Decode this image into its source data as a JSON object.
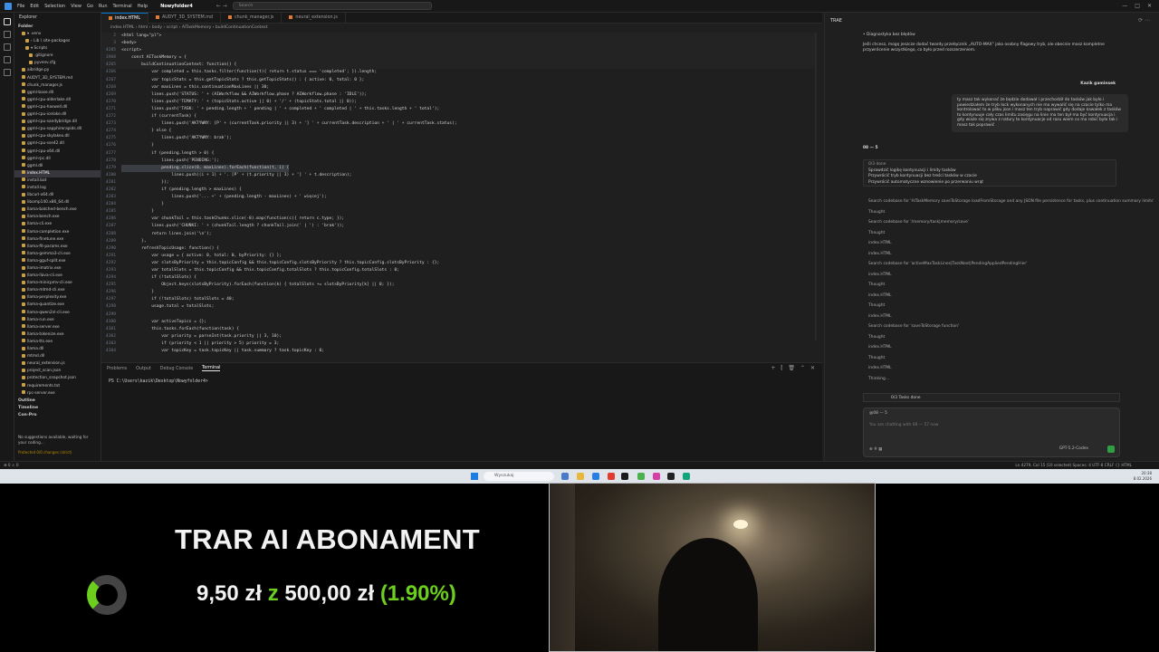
{
  "menu": [
    "File",
    "Edit",
    "Selection",
    "View",
    "Go",
    "Run",
    "Terminal",
    "Help"
  ],
  "project": "Nowyfolder4",
  "search_placeholder": "Search",
  "explorer": {
    "title": "Explorer",
    "root": "Folder",
    "items": [
      {
        "label": "▾ .venv",
        "indent": 8
      },
      {
        "label": "› Lib \\ site-packages",
        "indent": 12
      },
      {
        "label": "▾ Scripts",
        "indent": 12
      },
      {
        "label": ".gitignore",
        "indent": 16
      },
      {
        "label": "pyvenv.cfg",
        "indent": 16
      },
      {
        "label": "aibridge.py",
        "indent": 8
      },
      {
        "label": "AUDYT_3D_SYSTEM.md",
        "indent": 8
      },
      {
        "label": "chunk_manager.js",
        "indent": 8
      },
      {
        "label": "ggml-base.dll",
        "indent": 8
      },
      {
        "label": "ggml-cpu-alderlake.dll",
        "indent": 8
      },
      {
        "label": "ggml-cpu-haswell.dll",
        "indent": 8
      },
      {
        "label": "ggml-cpu-icelake.dll",
        "indent": 8
      },
      {
        "label": "ggml-cpu-sandybridge.dll",
        "indent": 8
      },
      {
        "label": "ggml-cpu-sapphirerapids.dll",
        "indent": 8
      },
      {
        "label": "ggml-cpu-skylakex.dll",
        "indent": 8
      },
      {
        "label": "ggml-cpu-sse42.dll",
        "indent": 8
      },
      {
        "label": "ggml-cpu-x64.dll",
        "indent": 8
      },
      {
        "label": "ggml-rpc.dll",
        "indent": 8
      },
      {
        "label": "ggml.dll",
        "indent": 8
      },
      {
        "label": "index.HTML",
        "indent": 8,
        "selected": true
      },
      {
        "label": "install.bat",
        "indent": 8
      },
      {
        "label": "install.log",
        "indent": 8
      },
      {
        "label": "libcurl-x64.dll",
        "indent": 8
      },
      {
        "label": "libomp140.x86_64.dll",
        "indent": 8
      },
      {
        "label": "llama-batched-bench.exe",
        "indent": 8
      },
      {
        "label": "llama-bench.exe",
        "indent": 8
      },
      {
        "label": "llama-cli.exe",
        "indent": 8
      },
      {
        "label": "llama-completion.exe",
        "indent": 8
      },
      {
        "label": "llama-finetune.exe",
        "indent": 8
      },
      {
        "label": "llama-fit-params.exe",
        "indent": 8
      },
      {
        "label": "llama-gemma3-cli.exe",
        "indent": 8
      },
      {
        "label": "llama-gguf-split.exe",
        "indent": 8
      },
      {
        "label": "llama-imatrix.exe",
        "indent": 8
      },
      {
        "label": "llama-llava-cli.exe",
        "indent": 8
      },
      {
        "label": "llama-minicpmv-cli.exe",
        "indent": 8
      },
      {
        "label": "llama-mtmd-cli.exe",
        "indent": 8
      },
      {
        "label": "llama-perplexity.exe",
        "indent": 8
      },
      {
        "label": "llama-quantize.exe",
        "indent": 8
      },
      {
        "label": "llama-qwen2vl-cli.exe",
        "indent": 8
      },
      {
        "label": "llama-run.exe",
        "indent": 8
      },
      {
        "label": "llama-server.exe",
        "indent": 8
      },
      {
        "label": "llama-tokenize.exe",
        "indent": 8
      },
      {
        "label": "llama-tts.exe",
        "indent": 8
      },
      {
        "label": "llama.dll",
        "indent": 8
      },
      {
        "label": "mtmd.dll",
        "indent": 8
      },
      {
        "label": "neural_extension.js",
        "indent": 8
      },
      {
        "label": "project_scan.json",
        "indent": 8
      },
      {
        "label": "protection_snapshot.json",
        "indent": 8
      },
      {
        "label": "requirements.txt",
        "indent": 8
      },
      {
        "label": "rpc-server.exe",
        "indent": 8
      }
    ],
    "outline": "Outline",
    "timeline": "Timeline",
    "section3": "Con-Pro",
    "note": "No suggestions available, waiting for your coding...",
    "note2": "Protected 0/0 changes (strict)"
  },
  "tabs": [
    {
      "label": "index.HTML",
      "active": true
    },
    {
      "label": "AUDYT_3D_SYSTEM.md",
      "active": false
    },
    {
      "label": "chunk_manager.js",
      "active": false
    },
    {
      "label": "neural_extension.js",
      "active": false
    }
  ],
  "breadcrumb": "index.HTML › html › body › script › AITaskMemory › buildContinuationContext",
  "code_lines": [
    {
      "n": "2",
      "t": "<html lang=\"pl\">",
      "sticky": true
    },
    {
      "n": "3",
      "t": "<body>",
      "sticky": true
    },
    {
      "n": "4285",
      "t": "<script>",
      "sticky": true
    },
    {
      "n": "3968",
      "t": "    const AITaskMemory = {",
      "sticky": true
    },
    {
      "n": "4265",
      "t": "        buildContinuationContext: function() {",
      "sticky": true
    },
    {
      "n": "4266",
      "t": "            var completed = this.tasks.filter(function(t){ return t.status === 'completed'; }).length;"
    },
    {
      "n": "4267",
      "t": "            var topicStats = this.getTopicStats ? this.getTopicStats() : { active: 0, total: 0 };"
    },
    {
      "n": "4268",
      "t": "            var maxLines = this.continuationMaxLines || 30;"
    },
    {
      "n": "4269",
      "t": "            lines.push('STATUS: ' + (AIWorkflow && AIWorkflow.phase ? AIWorkflow.phase : 'IDLE'));"
    },
    {
      "n": "4270",
      "t": "            lines.push('TEMATY: ' + (topicStats.active || 0) + '/' + (topicStats.total || 0));"
    },
    {
      "n": "4271",
      "t": "            lines.push('TASK: ' + pending.length + ' pending | ' + completed + ' completed | ' + this.tasks.length + ' total');"
    },
    {
      "n": "4272",
      "t": "            if (currentTask) {"
    },
    {
      "n": "4273",
      "t": "                lines.push('AKTYWNY: [P' + (currentTask.priority || 3) + '] ' + currentTask.description + ' | ' + currentTask.status);"
    },
    {
      "n": "4274",
      "t": "            } else {"
    },
    {
      "n": "4275",
      "t": "                lines.push('AKTYWNY: brak');"
    },
    {
      "n": "4276",
      "t": "            }"
    },
    {
      "n": "4277",
      "t": "            if (pending.length > 0) {"
    },
    {
      "n": "4278",
      "t": "                lines.push('PENDING:');"
    },
    {
      "n": "4279",
      "t": "                pending.slice(0, maxLines).forEach(function(t, i) {",
      "hl": true
    },
    {
      "n": "4280",
      "t": "                    lines.push((i + 1) + '. [P' + (t.priority || 3) + '] ' + t.description);"
    },
    {
      "n": "4281",
      "t": "                });"
    },
    {
      "n": "4282",
      "t": "                if (pending.length > maxLines) {"
    },
    {
      "n": "4283",
      "t": "                    lines.push('... +' + (pending.length - maxLines) + ' więcej');"
    },
    {
      "n": "4284",
      "t": "                }"
    },
    {
      "n": "4285",
      "t": "            }"
    },
    {
      "n": "4286",
      "t": "            var chunkTail = this.taskChunks.slice(-8).map(function(c){ return c.type; });"
    },
    {
      "n": "4287",
      "t": "            lines.push('CHUNKI: ' + (chunkTail.length ? chunkTail.join(' | ') : 'brak'));"
    },
    {
      "n": "4288",
      "t": "            return lines.join('\\n');"
    },
    {
      "n": "4289",
      "t": "        },"
    },
    {
      "n": "4290",
      "t": "        refreshTopicUsage: function() {"
    },
    {
      "n": "4291",
      "t": "            var usage = { active: 0, total: 0, byPriority: {} };"
    },
    {
      "n": "4292",
      "t": "            var slotsByPriority = this.topicConfig && this.topicConfig.slotsByPriority ? this.topicConfig.slotsByPriority : {};"
    },
    {
      "n": "4293",
      "t": "            var totalSlots = this.topicConfig && this.topicConfig.totalSlots ? this.topicConfig.totalSlots : 0;"
    },
    {
      "n": "4294",
      "t": "            if (!totalSlots) {"
    },
    {
      "n": "4295",
      "t": "                Object.keys(slotsByPriority).forEach(function(k) { totalSlots += slotsByPriority[k] || 0; });"
    },
    {
      "n": "4296",
      "t": "            }"
    },
    {
      "n": "4297",
      "t": "            if (!totalSlots) totalSlots = 40;"
    },
    {
      "n": "4298",
      "t": "            usage.total = totalSlots;"
    },
    {
      "n": "4299",
      "t": ""
    },
    {
      "n": "4300",
      "t": "            var activeTopics = {};"
    },
    {
      "n": "4301",
      "t": "            this.tasks.forEach(function(task) {"
    },
    {
      "n": "4302",
      "t": "                var priority = parseInt(task.priority || 3, 10);"
    },
    {
      "n": "4303",
      "t": "                if (priority < 1 || priority > 5) priority = 3;"
    },
    {
      "n": "4304",
      "t": "                var topicKey = task.topicKey || task.summary ? task.topicKey : 0;"
    }
  ],
  "panel": {
    "tabs": [
      "Problems",
      "Output",
      "Debug Console",
      "Terminal"
    ],
    "prompt": "PS C:\\Users\\kazik\\Desktop\\Nowyfolder4>"
  },
  "chat": {
    "title": "TRAE",
    "diag": "• Diagnostyka bez błędów",
    "intro": "Jeśli chcesz, mogę jeszcze dodać twardy przełącznik „AUTO-MAX\" jako osobny flagowy tryb, ale obecnie masz kompletne przywrócenie wszystkiego, co było przed rozszerzeniem.",
    "user_name": "Kazik gaminsek",
    "user_msg": "ty masz tak wykonać że będzie dodawał i przechodził do tasków jak było i powiedziałem że tryb lock wykonanych nie ma wywalić się na czacie tylko ma kontrolować to w pliku json i masz ten tryb naprawić gdy dodaje kawałek z tasków to kontynuuje cały czas limitu zasięgu na linie ma ten był ma być kontynuacja i gdy wiaże się zrywa z natury to kontynuacje od razu wiem co ma robić było tak i masz tak poprawić",
    "agent_name": "08 — 5",
    "todo_head": "0/3 done",
    "todos": [
      "Sprawdzić logikę kontynuacji i limity tasków",
      "Przywrócić tryb kontynuacji bez treści tasków w czacie",
      "Przywrócić automatyczne wznowienie po przerwaniu wrąt"
    ],
    "logs": [
      "Search codebase for 'AITaskMemory saveToStorage loadFromStorage and any JSON file persistence for tasks, plus continuation summary limits'",
      "Thought",
      "Search codebase for '/memory/task|memory/save'",
      "Thought",
      "index.HTML",
      "index.HTML",
      "Search codebase for 'activeMaxTaskLines|TaskNext|PendingAppliedPendingHier'",
      "index.HTML",
      "Thought",
      "index.HTML",
      "Thought",
      "index.HTML",
      "Search codebase for 'saveToStorage function'",
      "Thought",
      "index.HTML",
      "Thought",
      "index.HTML",
      "Thinking..."
    ],
    "todo_mini": "0/3 Tasks done",
    "ctx": "@08 — 5",
    "placeholder": "You are chatting with 08 — 57 now",
    "model": "GPT-5.2-Codex"
  },
  "statusbar": {
    "left": "⊗ 0 ⚠ 0",
    "right": "Ln 4279, Col 15 (10 selected)   Spaces: 4   UTF-8   CRLF   {} HTML"
  },
  "taskbar": {
    "search": "Wyszukaj",
    "time": "20:38",
    "date": "8.02.2026"
  },
  "overlay": {
    "title": "TRAR AI ABONAMENT",
    "amount": "9,50 zł",
    "of": "z",
    "goal": "500,00 zł",
    "percent": "(1.90%)",
    "progress": 0.019
  }
}
